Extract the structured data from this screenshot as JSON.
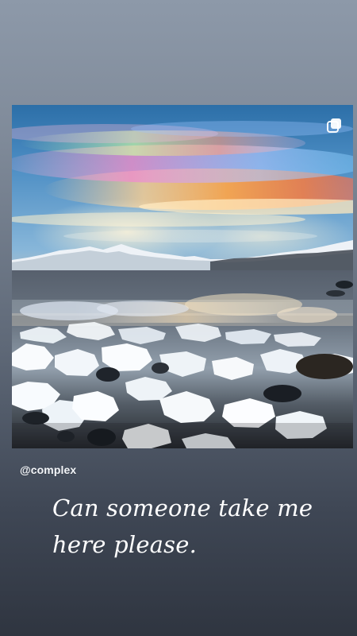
{
  "story": {
    "username": "@complex",
    "caption_lines": [
      "Can someone take me",
      "here please."
    ]
  },
  "post": {
    "image_subject": "iridescent nacreous clouds over snowy mountains and an icy shoreline",
    "icons": {
      "multi_post": "multiple-posts-icon"
    }
  },
  "colors": {
    "background_top": "#8d99a9",
    "background_bottom": "#2f3540",
    "text": "#ffffff"
  }
}
